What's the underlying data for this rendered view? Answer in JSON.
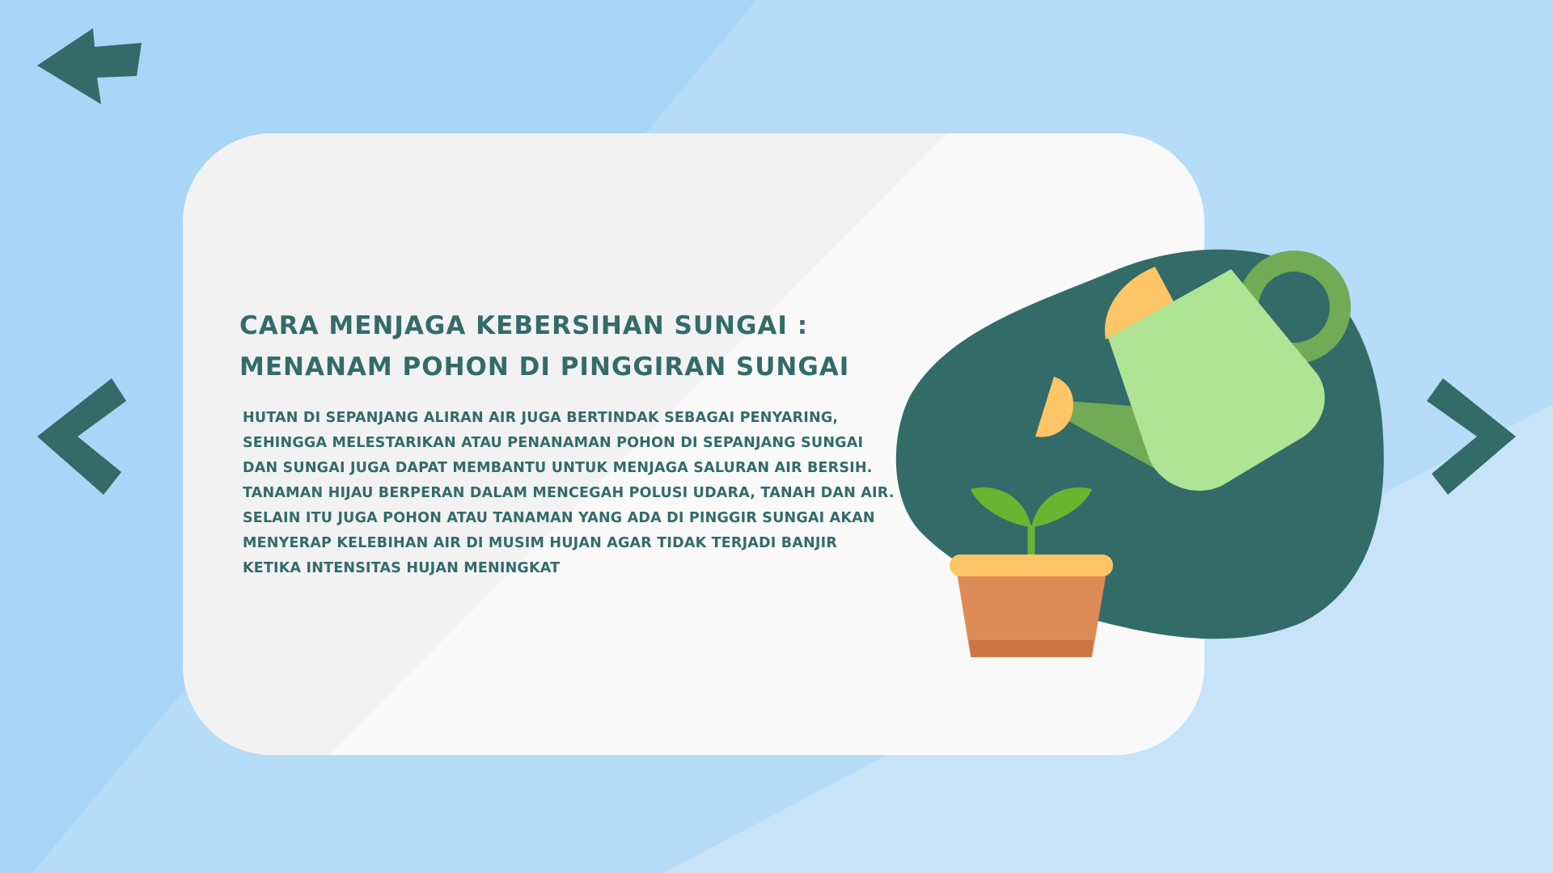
{
  "slide": {
    "title_lines": [
      "Cara menjaga kebersihan sungai :",
      "menanam pohon di pinggiran sungai"
    ],
    "body_lines": [
      "Hutan di sepanjang aliran air juga bertindak sebagai penyaring,",
      "sehingga melestarikan atau penanaman pohon di sepanjang sungai",
      "dan sungai juga dapat membantu untuk menjaga saluran air bersih.",
      "Tanaman hijau berperan dalam mencegah polusi udara, tanah dan air.",
      "Selain itu juga pohon atau tanaman yang ada di pinggir sungai akan",
      "menyerap kelebihan air di musim hujan agar tidak terjadi banjir",
      "ketika intensitas hujan meningkat"
    ]
  },
  "navigation": {
    "back_icon": "back-arrow-icon",
    "prev_icon": "chevron-left-icon",
    "next_icon": "chevron-right-icon"
  },
  "illustration": {
    "icons": [
      "watering-can-icon",
      "plant-pot-icon",
      "sprout-icon"
    ]
  },
  "colors": {
    "accent_dark_teal": "#336b68",
    "background_blue": "#a9d5f7",
    "card": "#f9f9fa",
    "can_body": "#aee494",
    "can_handle": "#72aa55",
    "pot": "#de8a57",
    "pot_rim": "#fdc566",
    "leaf": "#67b530"
  }
}
